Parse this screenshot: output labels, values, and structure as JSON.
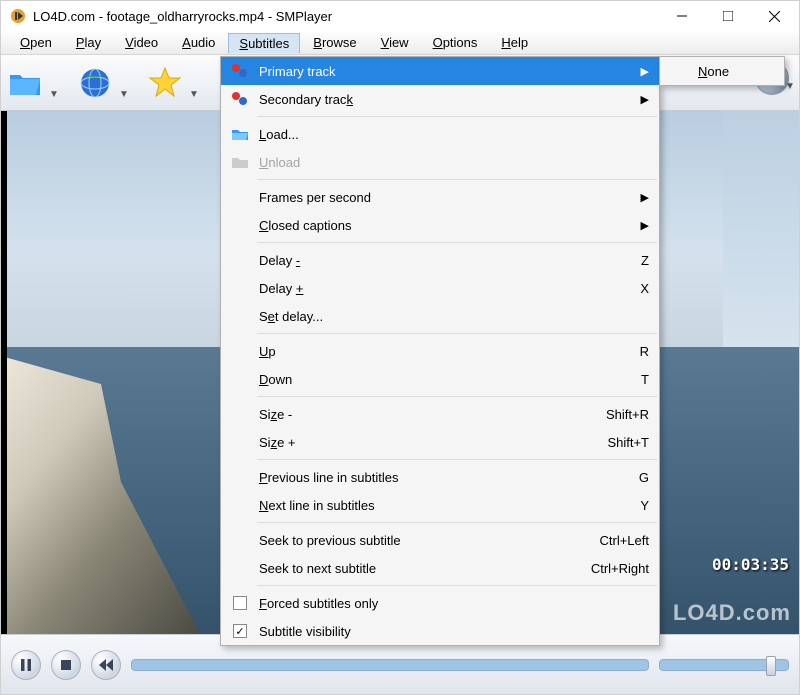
{
  "title": "LO4D.com - footage_oldharryrocks.mp4 - SMPlayer",
  "menubar": [
    "Open",
    "Play",
    "Video",
    "Audio",
    "Subtitles",
    "Browse",
    "View",
    "Options",
    "Help"
  ],
  "menubar_active_index": 4,
  "toolbar_icons": [
    "folder-open-icon",
    "globe-icon",
    "star-icon"
  ],
  "dropdown": {
    "groups": [
      [
        {
          "label": "Primary track",
          "icon": "tracks-icon",
          "arrow": true,
          "highlight": true
        },
        {
          "label": "Secondary track",
          "icon": "tracks-icon",
          "arrow": true,
          "accel": "k"
        }
      ],
      [
        {
          "label": "Load...",
          "icon": "folder-open-icon",
          "accel": "L"
        },
        {
          "label": "Unload",
          "icon": "folder-closed-icon",
          "disabled": true,
          "accel": "U"
        }
      ],
      [
        {
          "label": "Frames per second",
          "arrow": true
        },
        {
          "label": "Closed captions",
          "arrow": true,
          "accel": "C"
        }
      ],
      [
        {
          "label": "Delay -",
          "shortcut": "Z",
          "accel": "-"
        },
        {
          "label": "Delay +",
          "shortcut": "X",
          "accel": "+"
        },
        {
          "label": "Set delay...",
          "accel": "e"
        }
      ],
      [
        {
          "label": "Up",
          "shortcut": "R",
          "accel": "U"
        },
        {
          "label": "Down",
          "shortcut": "T",
          "accel": "D"
        }
      ],
      [
        {
          "label": "Size -",
          "shortcut": "Shift+R",
          "accel": "z"
        },
        {
          "label": "Size +",
          "shortcut": "Shift+T",
          "accel": "z"
        }
      ],
      [
        {
          "label": "Previous line in subtitles",
          "shortcut": "G",
          "accel": "P"
        },
        {
          "label": "Next line in subtitles",
          "shortcut": "Y",
          "accel": "N"
        }
      ],
      [
        {
          "label": "Seek to previous subtitle",
          "shortcut": "Ctrl+Left"
        },
        {
          "label": "Seek to next subtitle",
          "shortcut": "Ctrl+Right"
        }
      ],
      [
        {
          "label": "Forced subtitles only",
          "checkbox": true,
          "checked": false,
          "accel": "F"
        },
        {
          "label": "Subtitle visibility",
          "checkbox": true,
          "checked": true
        }
      ]
    ]
  },
  "submenu": {
    "items": [
      {
        "label": "None",
        "accel": "N"
      }
    ]
  },
  "playback": {
    "buttons": [
      "pause",
      "stop",
      "rewind"
    ],
    "timestamp": "00:03:35"
  },
  "watermark": "LO4D.com"
}
